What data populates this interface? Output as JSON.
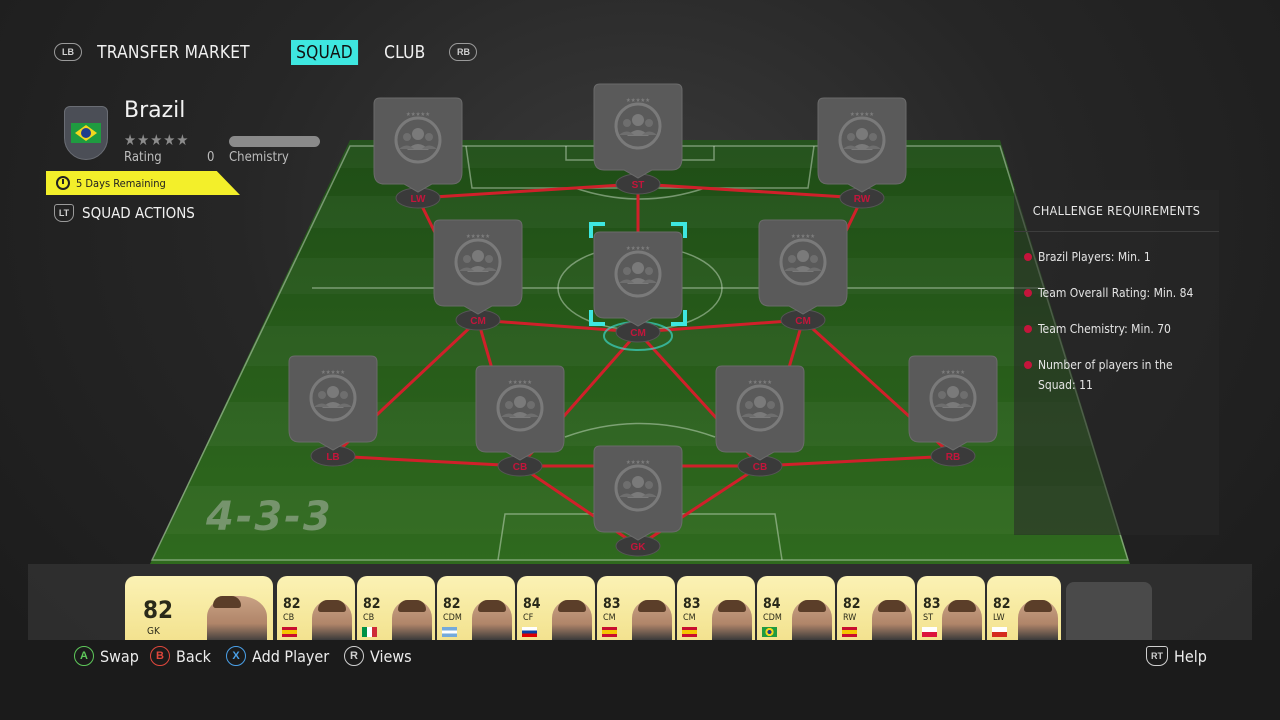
{
  "nav": {
    "left_bumper": "LB",
    "right_bumper": "RB",
    "tabs": [
      {
        "label": "TRANSFER MARKET",
        "active": false
      },
      {
        "label": "SQUAD",
        "active": true
      },
      {
        "label": "CLUB",
        "active": false
      }
    ]
  },
  "squad": {
    "name": "Brazil",
    "stars": "★★★★★",
    "rating_label": "Rating",
    "rating_value": "0",
    "chemistry_label": "Chemistry",
    "timer": "5 Days Remaining",
    "actions_trigger": "LT",
    "actions_label": "SQUAD ACTIONS",
    "formation": "4-3-3"
  },
  "positions": [
    {
      "label": "LW",
      "selected": false
    },
    {
      "label": "ST",
      "selected": false
    },
    {
      "label": "RW",
      "selected": false
    },
    {
      "label": "CM",
      "selected": false
    },
    {
      "label": "CM",
      "selected": true
    },
    {
      "label": "CM",
      "selected": false
    },
    {
      "label": "LB",
      "selected": false
    },
    {
      "label": "CB",
      "selected": false
    },
    {
      "label": "CB",
      "selected": false
    },
    {
      "label": "RB",
      "selected": false
    },
    {
      "label": "GK",
      "selected": false
    }
  ],
  "requirements": {
    "title": "CHALLENGE REQUIREMENTS",
    "items": [
      "Brazil Players: Min. 1",
      "Team Overall Rating: Min. 84",
      "Team Chemistry: Min. 70",
      "Number of players in the Squad: 11"
    ]
  },
  "bench": [
    {
      "rating": "82",
      "pos": "GK"
    },
    {
      "rating": "82",
      "pos": "CB",
      "flag": "es"
    },
    {
      "rating": "82",
      "pos": "CB",
      "flag": "it"
    },
    {
      "rating": "82",
      "pos": "CDM",
      "flag": "ar"
    },
    {
      "rating": "84",
      "pos": "CF",
      "flag": "si"
    },
    {
      "rating": "83",
      "pos": "CM",
      "flag": "es"
    },
    {
      "rating": "83",
      "pos": "CM",
      "flag": "es"
    },
    {
      "rating": "84",
      "pos": "CDM",
      "flag": "br"
    },
    {
      "rating": "82",
      "pos": "RW",
      "flag": "es"
    },
    {
      "rating": "83",
      "pos": "ST",
      "flag": "pl"
    },
    {
      "rating": "82",
      "pos": "LW",
      "flag": "cl"
    }
  ],
  "controls": {
    "swap": {
      "key": "A",
      "label": "Swap"
    },
    "back": {
      "key": "B",
      "label": "Back"
    },
    "add": {
      "key": "X",
      "label": "Add Player"
    },
    "views": {
      "key": "R",
      "label": "Views"
    },
    "help": {
      "key": "RT",
      "label": "Help"
    }
  },
  "colors": {
    "accent": "#3ee7e0",
    "timer": "#f3ef2a",
    "link_line": "#d0202a",
    "position_label": "#c4153b",
    "card_gold": "#f3e28f"
  }
}
